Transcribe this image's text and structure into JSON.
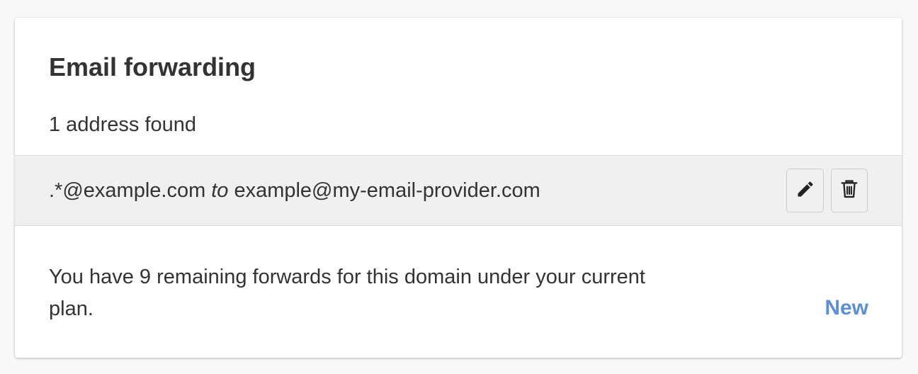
{
  "card": {
    "title": "Email forwarding",
    "count_text": "1 address found"
  },
  "forwards": [
    {
      "source": ".*@example.com",
      "connector": "to",
      "destination": "example@my-email-provider.com",
      "edit_icon": "pencil-icon",
      "delete_icon": "trash-icon"
    }
  ],
  "footer": {
    "message": "You have 9 remaining forwards for this domain under your current plan.",
    "new_label": "New"
  },
  "colors": {
    "link": "#5b8fd6",
    "row_background": "#f0f0f0",
    "text": "#333333"
  }
}
